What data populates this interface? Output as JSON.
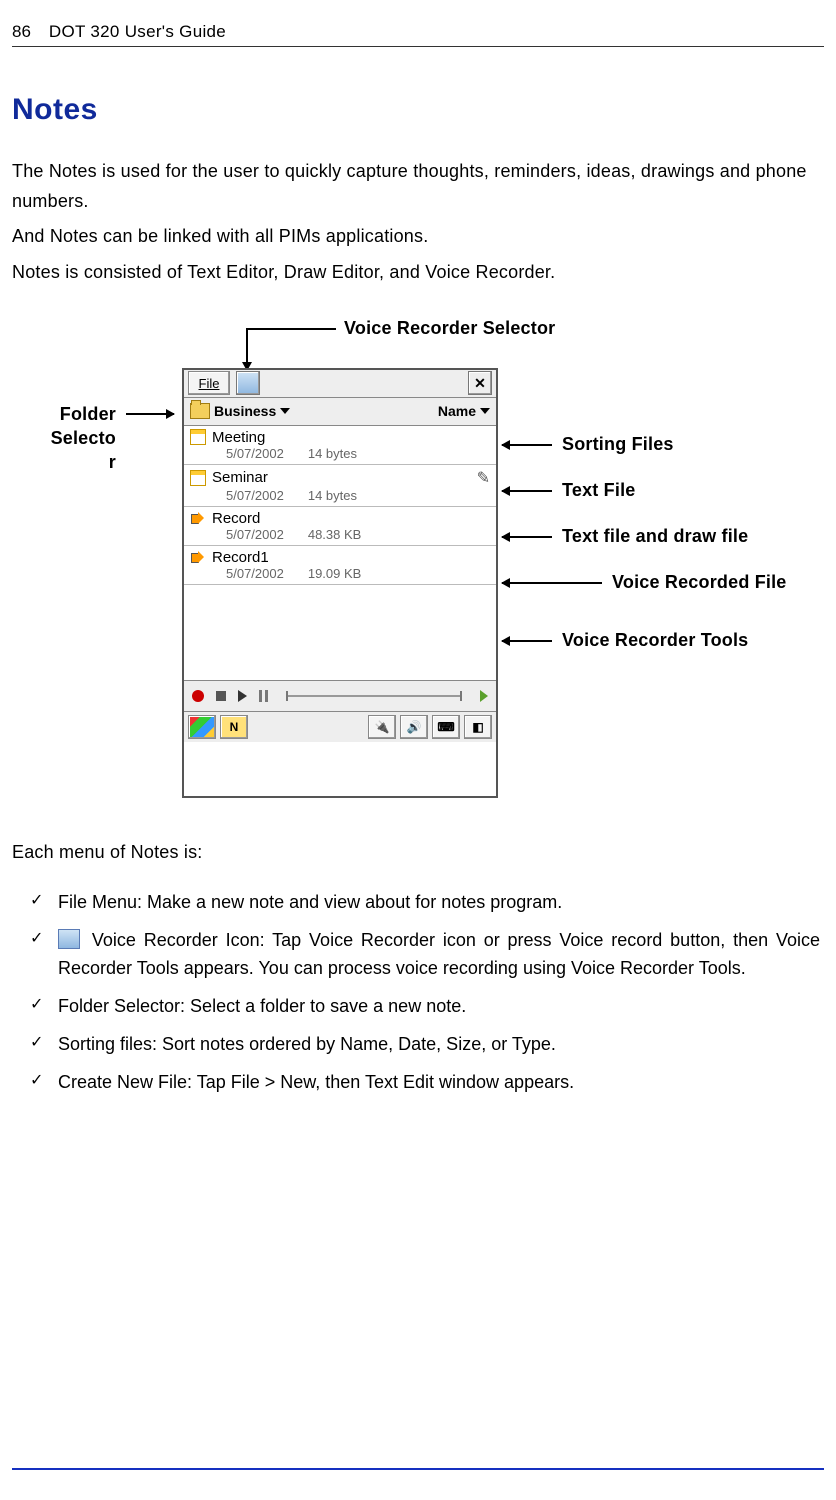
{
  "header": {
    "page_number": "86",
    "title": "DOT 320 User's Guide"
  },
  "section_title": "Notes",
  "paragraphs": {
    "p1": "The Notes is used for the user to quickly capture thoughts, reminders, ideas, drawings and phone numbers.",
    "p2": "And Notes can be linked with all PIMs applications.",
    "p3": "Notes is consisted of Text Editor, Draw Editor, and Voice Recorder."
  },
  "diagram": {
    "callouts": {
      "voice_recorder_selector": "Voice Recorder Selector",
      "folder_selector_line1": "Folder",
      "folder_selector_line2": "Selecto",
      "folder_selector_line3": "r",
      "sorting_files": "Sorting Files",
      "text_file": "Text File",
      "text_draw_file": "Text file and draw file",
      "voice_recorded_file": "Voice Recorded File",
      "voice_recorder_tools": "Voice Recorder Tools"
    },
    "window": {
      "file_menu_letter": "F",
      "file_menu_rest": "ile",
      "close": "✕",
      "folder_label": "Business",
      "sort_label": "Name",
      "items": [
        {
          "title": "Meeting",
          "date": "5/07/2002",
          "size": "14 bytes",
          "type": "note",
          "has_pen": false
        },
        {
          "title": "Seminar",
          "date": "5/07/2002",
          "size": "14 bytes",
          "type": "note",
          "has_pen": true
        },
        {
          "title": "Record",
          "date": "5/07/2002",
          "size": "48.38 KB",
          "type": "voice",
          "has_pen": false
        },
        {
          "title": "Record1",
          "date": "5/07/2002",
          "size": "19.09 KB",
          "type": "voice",
          "has_pen": false
        }
      ],
      "taskbar_n": "N"
    }
  },
  "menu_intro": "Each menu of Notes is:",
  "bullets": {
    "b1": "File Menu: Make a new note and view about for notes program.",
    "b2": " Voice Recorder Icon: Tap Voice Recorder icon or press Voice record button, then Voice Recorder Tools appears. You can process voice recording using Voice Recorder Tools.",
    "b3": "Folder Selector: Select a folder to save a new note.",
    "b4": "Sorting files: Sort notes ordered by Name, Date, Size, or Type.",
    "b5": "Create New File: Tap File > New, then Text Edit window appears."
  }
}
